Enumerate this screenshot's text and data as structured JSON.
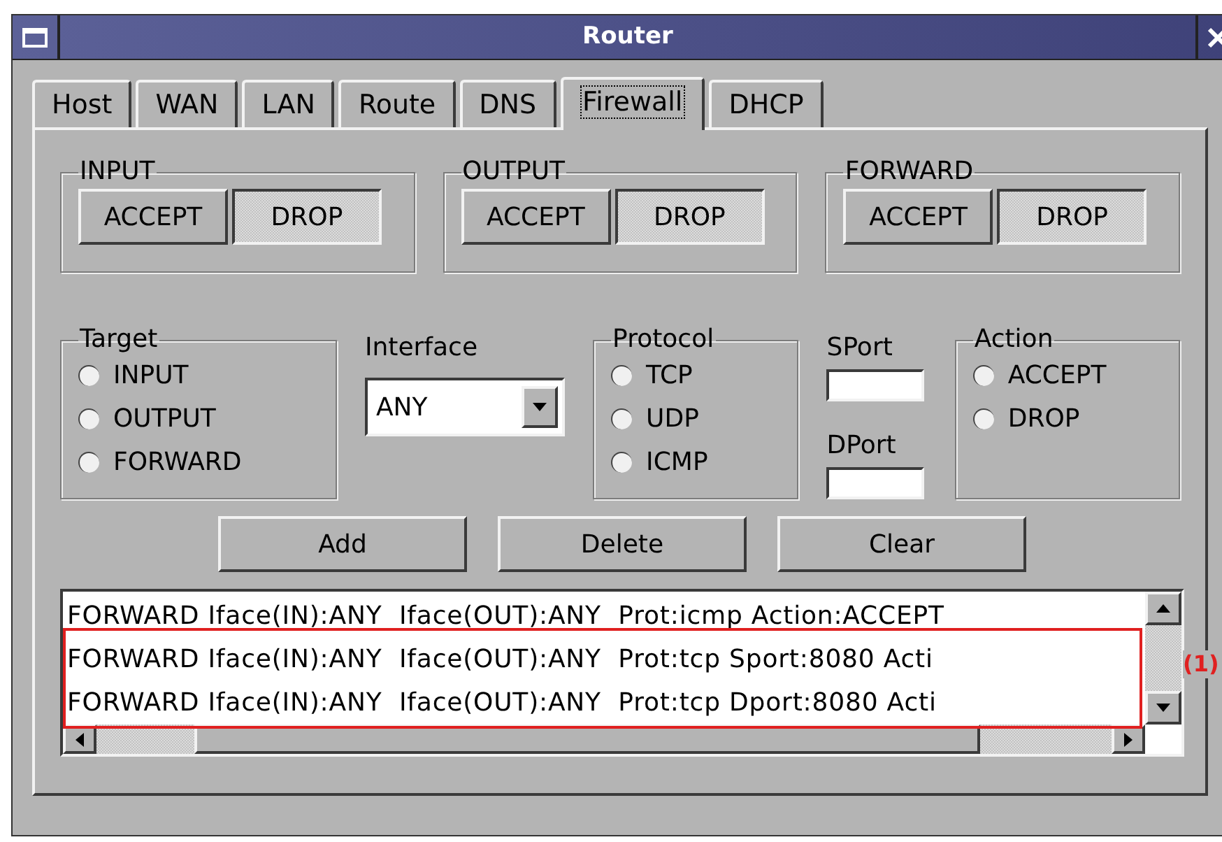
{
  "window": {
    "title": "Router"
  },
  "tabs": [
    {
      "label": "Host",
      "selected": false
    },
    {
      "label": "WAN",
      "selected": false
    },
    {
      "label": "LAN",
      "selected": false
    },
    {
      "label": "Route",
      "selected": false
    },
    {
      "label": "DNS",
      "selected": false
    },
    {
      "label": "Firewall",
      "selected": true
    },
    {
      "label": "DHCP",
      "selected": false
    }
  ],
  "policies": [
    {
      "title": "INPUT",
      "options": [
        {
          "label": "ACCEPT",
          "selected": false
        },
        {
          "label": "DROP",
          "selected": true
        }
      ]
    },
    {
      "title": "OUTPUT",
      "options": [
        {
          "label": "ACCEPT",
          "selected": false
        },
        {
          "label": "DROP",
          "selected": true
        }
      ]
    },
    {
      "title": "FORWARD",
      "options": [
        {
          "label": "ACCEPT",
          "selected": false
        },
        {
          "label": "DROP",
          "selected": true
        }
      ]
    }
  ],
  "target": {
    "title": "Target",
    "options": [
      {
        "label": "INPUT",
        "selected": false
      },
      {
        "label": "OUTPUT",
        "selected": false
      },
      {
        "label": "FORWARD",
        "selected": false
      }
    ]
  },
  "interface": {
    "label": "Interface",
    "value": "ANY"
  },
  "protocol": {
    "title": "Protocol",
    "options": [
      {
        "label": "TCP",
        "selected": false
      },
      {
        "label": "UDP",
        "selected": false
      },
      {
        "label": "ICMP",
        "selected": false
      }
    ]
  },
  "sport": {
    "label": "SPort"
  },
  "dport": {
    "label": "DPort"
  },
  "action": {
    "title": "Action",
    "options": [
      {
        "label": "ACCEPT",
        "selected": false
      },
      {
        "label": "DROP",
        "selected": false
      }
    ]
  },
  "buttons": [
    "Add",
    "Delete",
    "Clear"
  ],
  "rules": [
    "FORWARD Iface(IN):ANY  Iface(OUT):ANY  Prot:icmp Action:ACCEPT",
    "FORWARD Iface(IN):ANY  Iface(OUT):ANY  Prot:tcp Sport:8080 Acti",
    "FORWARD Iface(IN):ANY  Iface(OUT):ANY  Prot:tcp Dport:8080 Acti"
  ],
  "annotation": {
    "label": "(1)"
  }
}
